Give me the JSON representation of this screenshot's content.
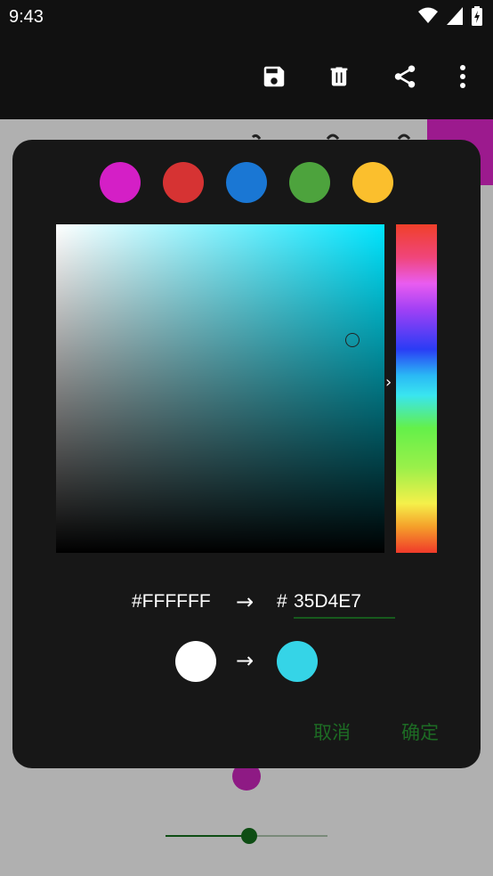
{
  "status_bar": {
    "time": "9:43",
    "icons": [
      "wifi-icon",
      "cellular-signal-icon",
      "battery-charging-icon"
    ]
  },
  "app_bar": {
    "actions": [
      "save-icon",
      "delete-icon",
      "share-icon",
      "more-vert-icon"
    ]
  },
  "color_dialog": {
    "preset_swatches": [
      "#d41fc6",
      "#d63333",
      "#1a77d4",
      "#4da33d",
      "#fbbf2d"
    ],
    "sv_panel_hue": "#00e5ff",
    "old_hex": "#FFFFFF",
    "hex_prefix": "#",
    "new_hex": "35D4E7",
    "old_color": "#FFFFFF",
    "new_color": "#35D4E7",
    "cancel_label": "取消",
    "ok_label": "确定",
    "accent_color": "#1d6b24"
  },
  "background": {
    "corner_color": "#9c1a8e",
    "slider_color": "#0e4d14",
    "slider_value": 0.5
  }
}
